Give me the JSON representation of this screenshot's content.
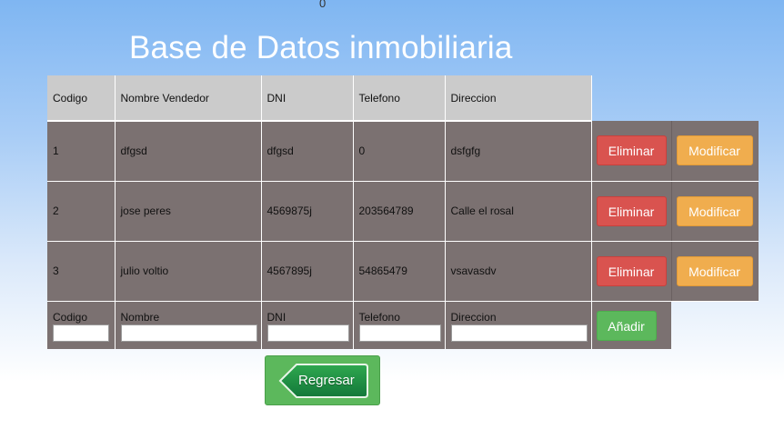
{
  "counter": "0",
  "title": "Base de Datos inmobiliaria",
  "columns": {
    "codigo": "Codigo",
    "nombre": "Nombre Vendedor",
    "dni": "DNI",
    "telefono": "Telefono",
    "direccion": "Direccion"
  },
  "rows": [
    {
      "codigo": "1",
      "nombre": "dfgsd",
      "dni": "dfgsd",
      "telefono": "0",
      "direccion": "dsfgfg"
    },
    {
      "codigo": "2",
      "nombre": "jose peres",
      "dni": "4569875j",
      "telefono": "203564789",
      "direccion": "Calle el rosal"
    },
    {
      "codigo": "3",
      "nombre": "julio voltio",
      "dni": "4567895j",
      "telefono": "54865479",
      "direccion": "vsavasdv"
    }
  ],
  "actions": {
    "delete_label": "Eliminar",
    "modify_label": "Modificar",
    "add_label": "Añadir",
    "back_label": "Regresar"
  },
  "form": {
    "codigo_label": "Codigo",
    "nombre_label": "Nombre",
    "dni_label": "DNI",
    "telefono_label": "Telefono",
    "direccion_label": "Direccion",
    "codigo_value": "",
    "nombre_value": "",
    "dni_value": "",
    "telefono_value": "",
    "direccion_value": ""
  },
  "colors": {
    "delete": "#d9534f",
    "modify": "#f0ad4e",
    "add": "#5cb85c",
    "row_bg": "#7b7171",
    "header_bg": "#cbcbcb"
  }
}
